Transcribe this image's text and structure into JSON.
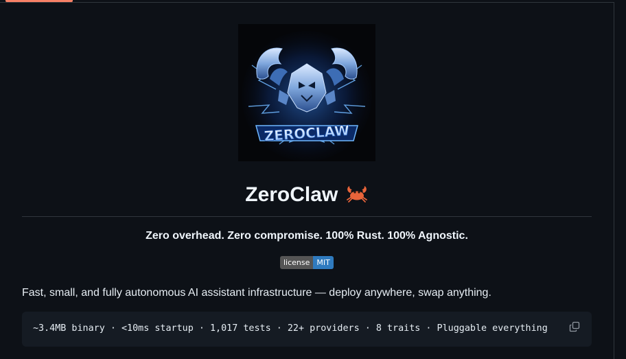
{
  "readme": {
    "logo_text": "ZEROCLAW",
    "title": "ZeroClaw",
    "title_emoji": "crab-icon",
    "tagline": "Zero overhead. Zero compromise. 100% Rust. 100% Agnostic.",
    "badge": {
      "label": "license",
      "value": "MIT"
    },
    "description": "Fast, small, and fully autonomous AI assistant infrastructure — deploy anywhere, swap anything.",
    "code": "~3.4MB binary · <10ms startup · 1,017 tests · 22+ providers · 8 traits · Pluggable everything",
    "copy_icon": "copy-icon"
  },
  "colors": {
    "background": "#0d1117",
    "code_background": "#151b23",
    "badge_left": "#555555",
    "badge_right": "#2f7bbf",
    "tab_accent": "#f78166"
  }
}
